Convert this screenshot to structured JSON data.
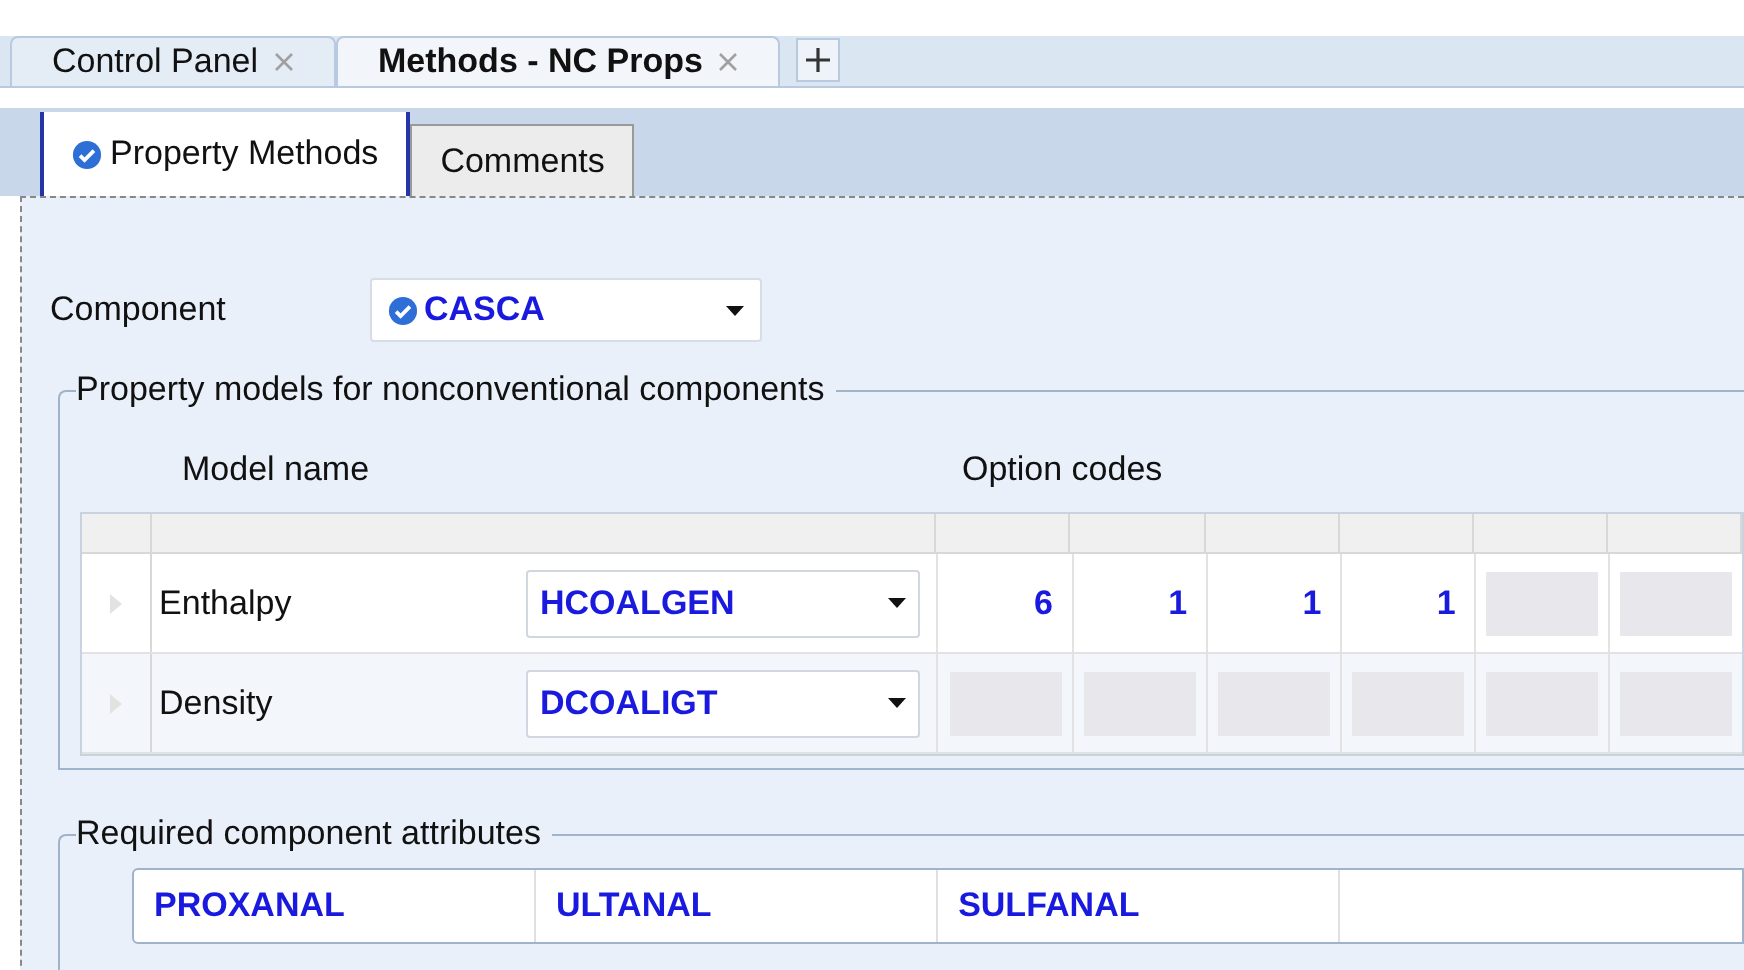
{
  "document_tabs": [
    {
      "label": "Control Panel",
      "selected": false
    },
    {
      "label": "Methods - NC Props",
      "selected": true
    }
  ],
  "sheet_tabs": [
    {
      "label": "Property Methods",
      "selected": true,
      "complete": true
    },
    {
      "label": "Comments",
      "selected": false,
      "complete": false
    }
  ],
  "component": {
    "label": "Component",
    "value": "CASCA"
  },
  "property_models": {
    "title": "Property models for nonconventional components",
    "columns": [
      "Model name",
      "Option codes"
    ],
    "rows": [
      {
        "name": "Enthalpy",
        "model": "HCOALGEN",
        "option_codes": [
          "6",
          "1",
          "1",
          "1"
        ]
      },
      {
        "name": "Density",
        "model": "DCOALIGT",
        "option_codes": []
      }
    ]
  },
  "required_attributes": {
    "title": "Required component attributes",
    "values": [
      "PROXANAL",
      "ULTANAL",
      "SULFANAL"
    ]
  }
}
